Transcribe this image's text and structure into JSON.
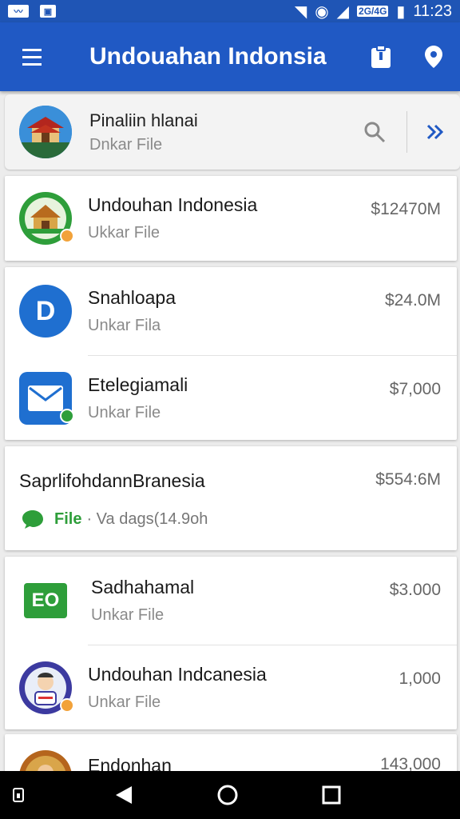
{
  "status_bar": {
    "time": "11:23",
    "mini_label": "2G/4G",
    "left_icons": [
      "notification-icon",
      "screenshot-icon"
    ]
  },
  "app_bar": {
    "title": "Undouahan Indonsia",
    "actions": [
      "clipboard-icon",
      "location-pin-icon"
    ]
  },
  "search_card": {
    "title": "Pinaliin hlanai",
    "subtitle": "Dnkar File"
  },
  "items": [
    {
      "name": "Undouhan Indonesia",
      "sub": "Ukkar File",
      "price": "$12470M"
    },
    {
      "name": "Snahloapa",
      "sub": "Unkar Fila",
      "price": "$24.0M"
    },
    {
      "name": "Etelegiamali",
      "sub": "Unkar File",
      "price": "$7,000"
    },
    {
      "name": "SaprlifohdannBranesia",
      "file_label": "File",
      "file_detail": "· Va dags(14.9oh",
      "price": "$554:6M"
    },
    {
      "name": "Sadhahamal",
      "sub": "Unkar File",
      "price": "$3.000"
    },
    {
      "name": "Undouhan Indcanesia",
      "sub": "Unkar File",
      "price": "1,000"
    },
    {
      "name": "Endonhan",
      "price": "143,000"
    }
  ],
  "colors": {
    "primary": "#2059c4",
    "status_bar": "#1f55b5",
    "accent_green": "#2e9e3a",
    "accent_orange": "#f2a23a"
  }
}
